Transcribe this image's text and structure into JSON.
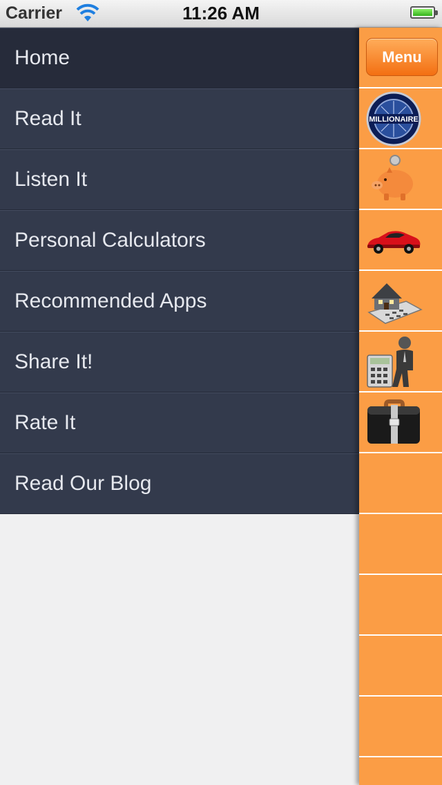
{
  "status_bar": {
    "carrier": "Carrier",
    "time": "11:26 AM"
  },
  "menu_button": {
    "label": "Menu"
  },
  "menu": {
    "items": [
      {
        "label": "Home",
        "active": true
      },
      {
        "label": "Read It"
      },
      {
        "label": "Listen It"
      },
      {
        "label": "Personal Calculators"
      },
      {
        "label": "Recommended Apps"
      },
      {
        "label": "Share It!"
      },
      {
        "label": "Rate It"
      },
      {
        "label": "Read Our Blog"
      }
    ]
  },
  "strip_icons": [
    {
      "name": "millionaire-logo-icon"
    },
    {
      "name": "piggy-bank-icon"
    },
    {
      "name": "red-sports-car-icon"
    },
    {
      "name": "house-calculator-icon"
    },
    {
      "name": "businessman-calculator-icon"
    },
    {
      "name": "briefcase-icon"
    }
  ],
  "colors": {
    "menu_bg": "#333a4c",
    "menu_active": "#262b3a",
    "strip": "#fb9d45",
    "button": "#f36f12"
  }
}
